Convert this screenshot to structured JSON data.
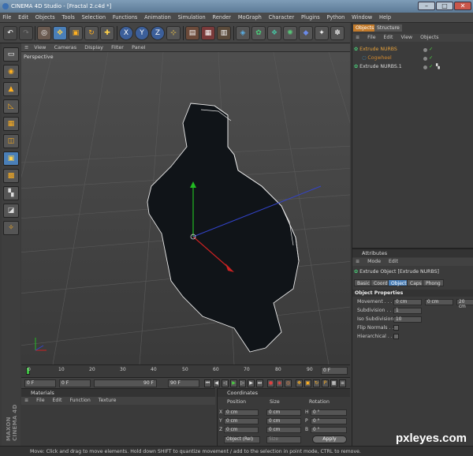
{
  "window": {
    "app_title": "CINEMA 4D Studio - [Fractal 2.c4d *]",
    "buttons": [
      "–",
      "□",
      "✕"
    ]
  },
  "menubar": [
    "File",
    "Edit",
    "Objects",
    "Tools",
    "Selection",
    "Functions",
    "Animation",
    "Simulation",
    "Render",
    "MoGraph",
    "Character",
    "Plugins",
    "Python",
    "Window",
    "Help"
  ],
  "toolbar": {
    "icons": [
      "undo-icon",
      "redo-icon",
      "live-selection-icon",
      "move-icon",
      "scale-icon",
      "rotate-icon",
      "last-tool-icon",
      "x-axis-icon",
      "y-axis-icon",
      "z-axis-icon",
      "coordinate-system-icon",
      "render-view-icon",
      "render-picture-viewer-icon",
      "render-settings-icon",
      "cube-icon",
      "nurbs-icon",
      "array-icon",
      "sphere-icon",
      "deformer-icon",
      "light-icon",
      "scene-icon"
    ],
    "axis_labels": [
      "X",
      "Y",
      "Z"
    ]
  },
  "viewport": {
    "menu": [
      "View",
      "Cameras",
      "Display",
      "Filter",
      "Panel"
    ],
    "label": "Perspective"
  },
  "timeline": {
    "ticks": [
      "0",
      "10",
      "20",
      "30",
      "40",
      "50",
      "60",
      "70",
      "80",
      "90"
    ],
    "end_field": "0 F"
  },
  "transport": {
    "start": "0 F",
    "current": "0 F",
    "min": "90 F",
    "max": "90 F"
  },
  "materials": {
    "title": "Materials",
    "menu": [
      "File",
      "Edit",
      "Function",
      "Texture"
    ]
  },
  "coordinates": {
    "title": "Coordinates",
    "headers": [
      "Position",
      "Size",
      "Rotation"
    ],
    "rows": [
      {
        "axis": "X",
        "pos": "0 cm",
        "size": "0 cm",
        "rot_label": "H",
        "rot": "0 °"
      },
      {
        "axis": "Y",
        "pos": "0 cm",
        "size": "0 cm",
        "rot_label": "P",
        "rot": "0 °"
      },
      {
        "axis": "Z",
        "pos": "0 cm",
        "size": "0 cm",
        "rot_label": "B",
        "rot": "0 °"
      }
    ],
    "mode_select": "Object (Rel)",
    "size_select": "Size",
    "apply": "Apply"
  },
  "objects_panel": {
    "tabs": [
      "Objects",
      "Structure"
    ],
    "menu": [
      "File",
      "Edit",
      "View",
      "Objects"
    ],
    "items": [
      {
        "name": "Extrude NURBS",
        "color": "#e8a23a",
        "level": 0
      },
      {
        "name": "Cogwheel",
        "color": "#d1882f",
        "level": 1
      },
      {
        "name": "Extrude NURBS.1",
        "color": "#d9d9d9",
        "level": 0
      }
    ]
  },
  "attributes_panel": {
    "title": "Attributes",
    "menu": [
      "Mode",
      "Edit"
    ],
    "object_label": "Extrude Object [Extrude NURBS]",
    "tabs": [
      "Basic",
      "Coord.",
      "Object",
      "Caps",
      "Phong"
    ],
    "active_tab": "Object",
    "section": "Object Properties",
    "props": [
      {
        "label": "Movement . . . .",
        "values": [
          "0 cm",
          "0 cm",
          "20 cm"
        ]
      },
      {
        "label": "Subdivision . . .",
        "values": [
          "1"
        ]
      },
      {
        "label": "Iso Subdivision",
        "values": [
          "10"
        ]
      },
      {
        "label": "Flip Normals . .",
        "values": []
      },
      {
        "label": "Hierarchical . . .",
        "values": []
      }
    ]
  },
  "status": "Move: Click and drag to move elements. Hold down SHIFT to quantize movement / add to the selection in point mode, CTRL to remove.",
  "logo_text": "MAXON CINEMA 4D",
  "watermark": "pxleyes.com",
  "colors": {
    "accent_blue": "#4a7fb8",
    "selected_object": "#e8a23a",
    "axis_x": "#cc2222",
    "axis_y": "#22bb22",
    "axis_z": "#3344cc"
  }
}
